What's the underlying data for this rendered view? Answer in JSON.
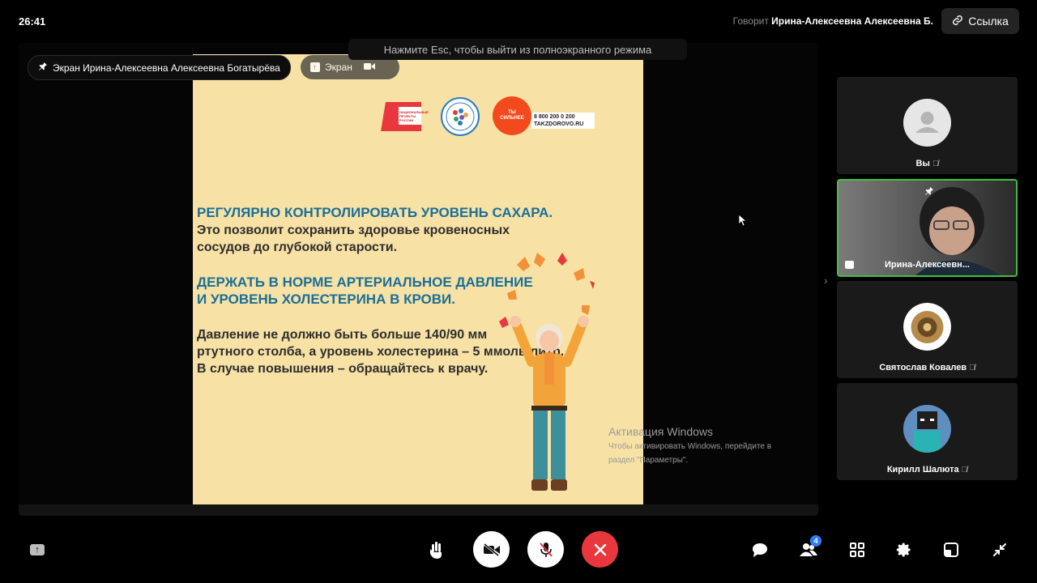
{
  "header": {
    "timer": "26:41",
    "speaking_prefix": "Говорит",
    "speaking_name": "Ирина-Алексеевна Алексеевна Б.",
    "link_label": "Ссылка",
    "esc_hint": "Нажмите Esc, чтобы выйти из полноэкранного режима"
  },
  "stage": {
    "screen_label": "Экран Ирина-Алексеевна Алексеевна Богатырёва",
    "screen_chip": "Экран"
  },
  "slide": {
    "logo_text_1": "НАЦИОНАЛЬНЫЕ ПРОЕКТЫ РОССИИ",
    "logo_text_3": "ТЫ СИЛЬНЕЕ",
    "phone": "8 800 200 0 200",
    "site": "TAKZDOROVO.RU",
    "heading1": "РЕГУЛЯРНО КОНТРОЛИРОВАТЬ УРОВЕНЬ САХАРА.",
    "text1_line1": "Это позволит сохранить здоровье кровеносных",
    "text1_line2": "сосудов до глубокой старости.",
    "heading2_line1": "ДЕРЖАТЬ В НОРМЕ АРТЕРИАЛЬНОЕ ДАВЛЕНИЕ",
    "heading2_line2": "И УРОВЕНЬ ХОЛЕСТЕРИНА В КРОВИ.",
    "text2_line1": "Давление не должно быть больше 140/90 мм",
    "text2_line2": "ртутного столба, а уровень холестерина – 5 ммоль/литр.",
    "text2_line3": "В случае повышения – обращайтесь к врачу."
  },
  "windows_activation": {
    "title": "Активация Windows",
    "line1": "Чтобы активировать Windows, перейдите в",
    "line2": "раздел \"Параметры\"."
  },
  "participants": [
    {
      "name": "Вы",
      "muted": true
    },
    {
      "name": "Ирина-Алексеевн...",
      "muted": false
    },
    {
      "name": "Святослав Ковалев",
      "muted": true
    },
    {
      "name": "Кирилл Шалюта",
      "muted": true
    }
  ],
  "controls": {
    "participants_badge": "4",
    "colors": {
      "hangup": "#e8383d",
      "active_tile_border": "#3fbf3f",
      "badge": "#2f7cf6"
    }
  }
}
